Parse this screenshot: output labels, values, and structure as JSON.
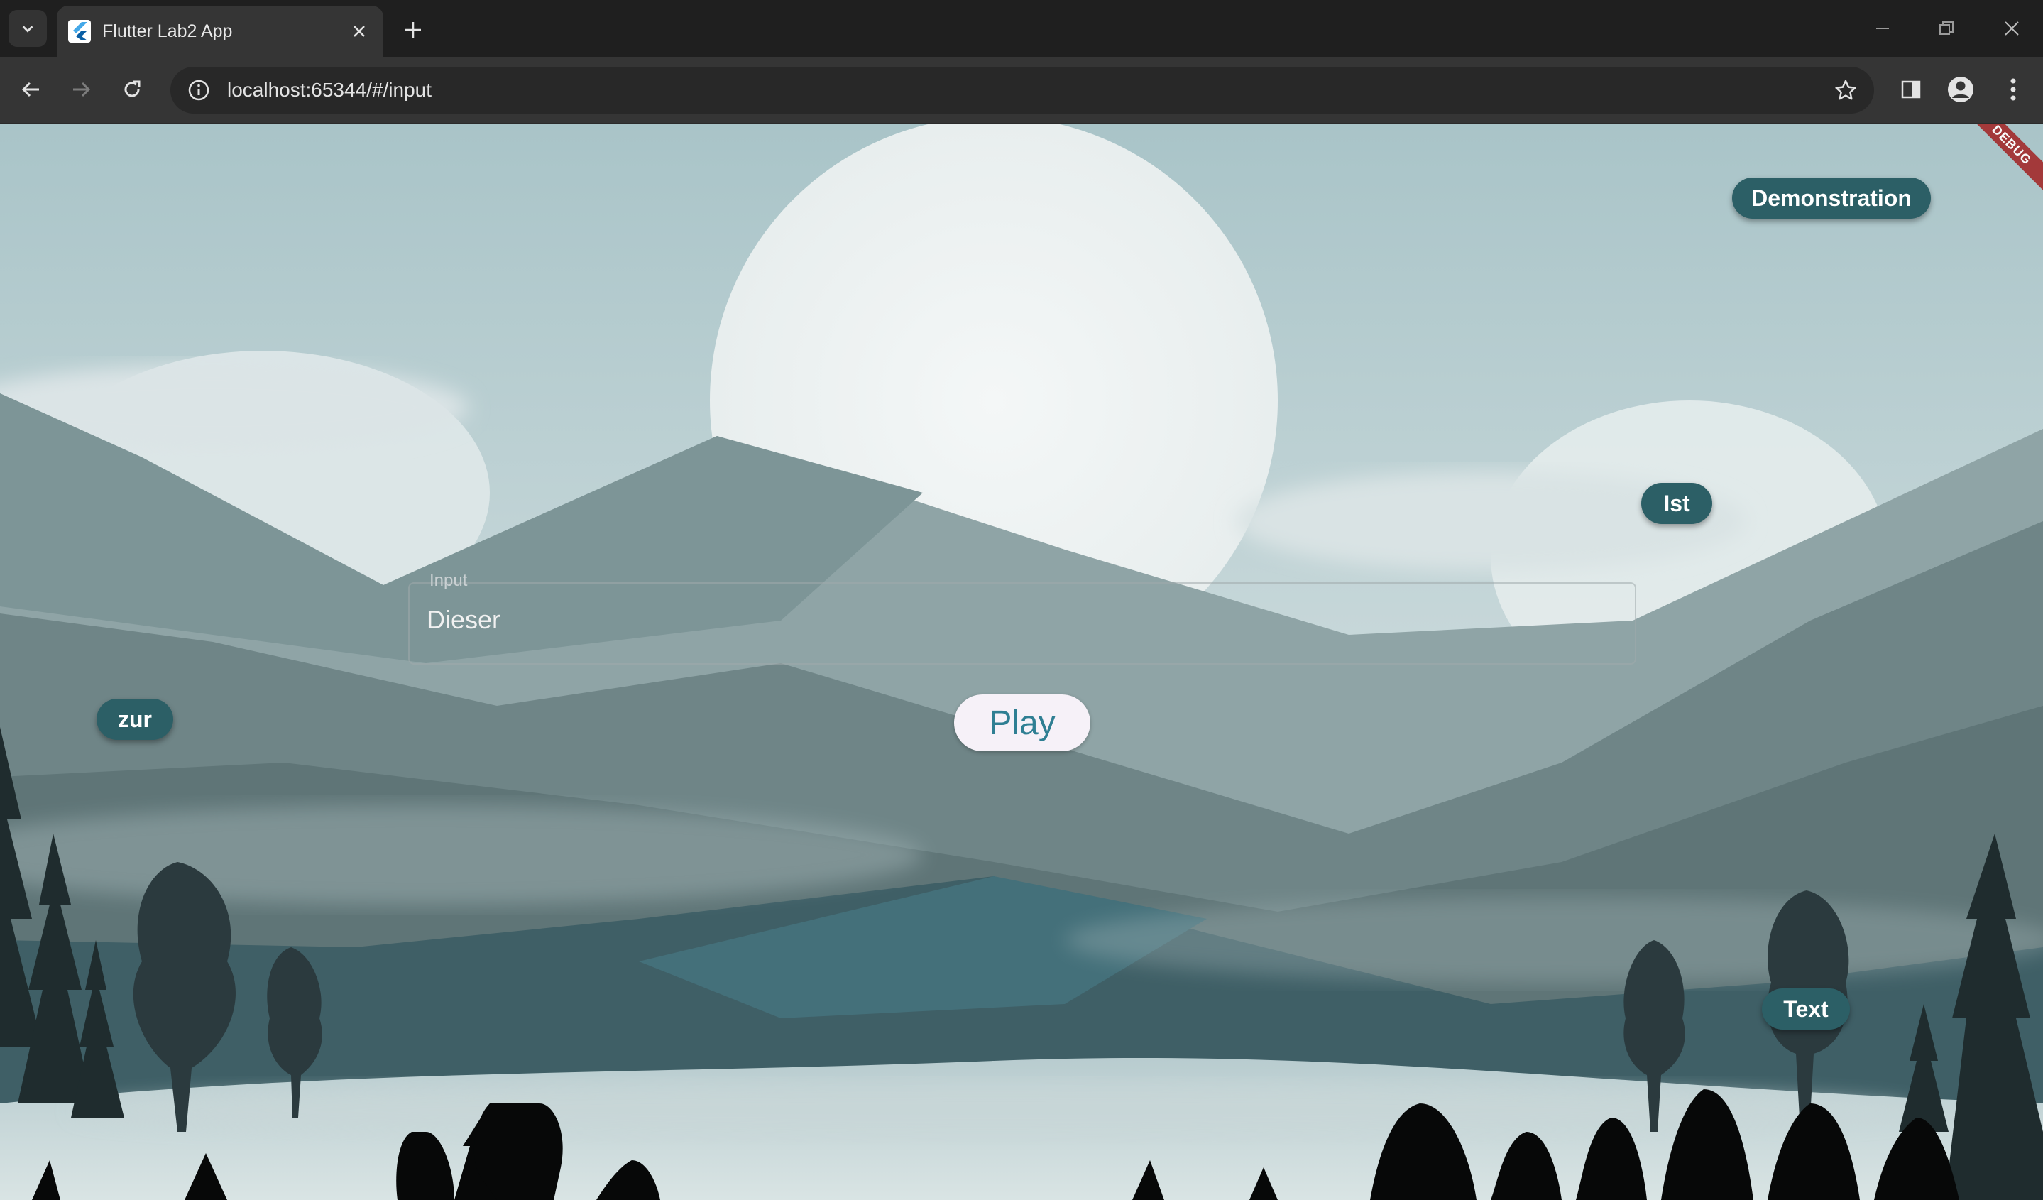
{
  "browser": {
    "tab_title": "Flutter Lab2 App",
    "url": "localhost:65344/#/input"
  },
  "app": {
    "debug_banner": "DEBUG",
    "input": {
      "label": "Input",
      "value": "Dieser"
    },
    "play_label": "Play",
    "word_chips": [
      {
        "id": "demonstration",
        "label": "Demonstration"
      },
      {
        "id": "ist",
        "label": "Ist"
      },
      {
        "id": "zur",
        "label": "zur"
      },
      {
        "id": "text",
        "label": "Text"
      }
    ]
  },
  "colors": {
    "chip_bg": "#2c5f66",
    "play_text": "#2f7f93",
    "play_bg": "#f6f1f8",
    "debug_banner": "#a32e2e"
  }
}
